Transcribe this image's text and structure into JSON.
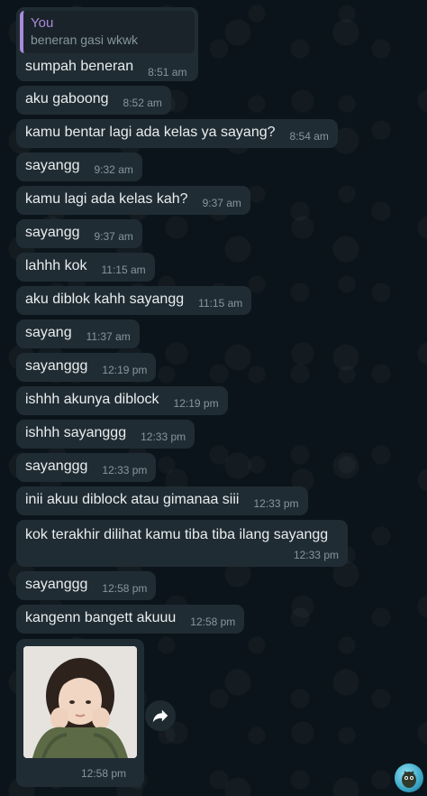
{
  "quoted_message": {
    "author": "You",
    "quoted_text": "beneran gasi wkwk",
    "text": "sumpah beneran",
    "time": "8:51 am"
  },
  "messages": [
    {
      "text": "aku gaboong",
      "time": "8:52 am"
    },
    {
      "text": "kamu bentar lagi ada kelas ya sayang?",
      "time": "8:54 am"
    },
    {
      "text": "sayangg",
      "time": "9:32 am"
    },
    {
      "text": "kamu lagi ada kelas kah?",
      "time": "9:37 am"
    },
    {
      "text": "sayangg",
      "time": "9:37 am"
    },
    {
      "text": "lahhh kok",
      "time": "11:15 am"
    },
    {
      "text": "aku diblok kahh sayangg",
      "time": "11:15 am"
    },
    {
      "text": "sayang",
      "time": "11:37 am"
    },
    {
      "text": "sayanggg",
      "time": "12:19 pm"
    },
    {
      "text": "ishhh akunya diblock",
      "time": "12:19 pm"
    },
    {
      "text": "ishhh sayanggg",
      "time": "12:33 pm"
    },
    {
      "text": "sayanggg",
      "time": "12:33 pm"
    },
    {
      "text": "inii akuu diblock atau gimanaa siii",
      "time": "12:33 pm"
    }
  ],
  "long_message": {
    "text": "kok terakhir dilihat kamu tiba tiba ilang sayangg",
    "time": "12:33 pm"
  },
  "messages_after": [
    {
      "text": "sayanggg",
      "time": "12:58 pm"
    },
    {
      "text": "kangenn bangett akuuu",
      "time": "12:58 pm"
    }
  ],
  "image_message": {
    "time": "12:58 pm"
  },
  "icons": {
    "forward": "forward-arrow-icon",
    "fab": "bot-avatar-icon"
  },
  "colors": {
    "background": "#0b141a",
    "bubble": "#202c33",
    "text": "#e9edef",
    "meta": "#8696a0",
    "quote_accent": "#a88bdc"
  }
}
